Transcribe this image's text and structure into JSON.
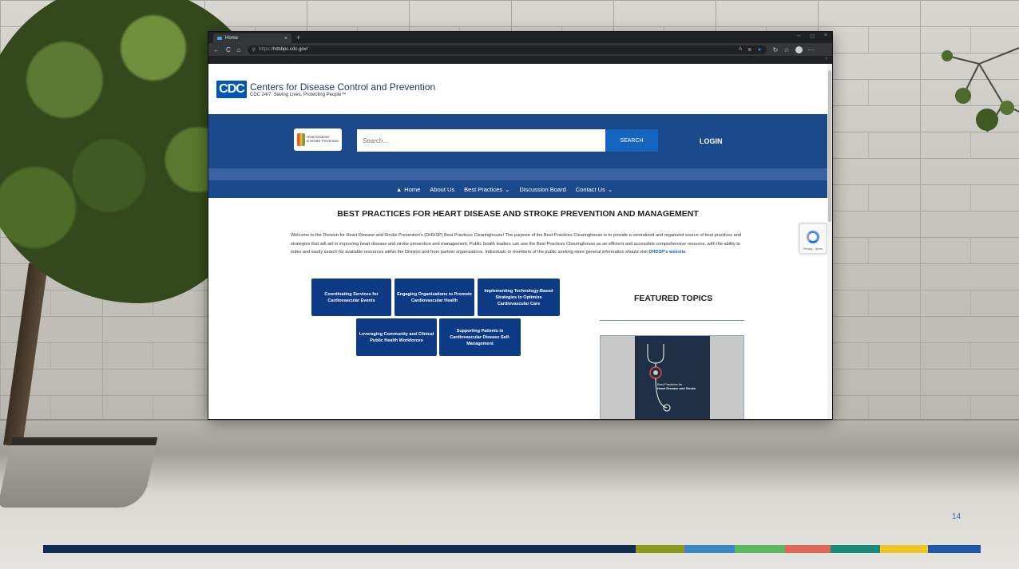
{
  "browser": {
    "tab_title": "Home",
    "tab_close": "×",
    "new_tab": "+",
    "window_controls": [
      "–",
      "◻",
      "×"
    ],
    "nav_icons": [
      "←",
      "C",
      "⌂"
    ],
    "lock": "⚲",
    "url_prefix": "https://",
    "url_host": "hdsbpc.cdc.gov",
    "url_suffix": "/",
    "more": "···",
    "subbar_chevron": "›"
  },
  "site": {
    "org_name": "Centers for Disease Control and Prevention",
    "tagline": "CDC 24/7: Saving Lives, Protecting People™",
    "logo_text": "CDC",
    "program_logo_line1": "Heart Disease",
    "program_logo_line2": "& Stroke Prevention",
    "search_placeholder": "Search...",
    "search_button": "SEARCH",
    "login": "LOGIN",
    "nav": [
      {
        "label": "Home",
        "icon": "home-icon"
      },
      {
        "label": "About Us"
      },
      {
        "label": "Best Practices",
        "dropdown": true
      },
      {
        "label": "Discussion Board"
      },
      {
        "label": "Contact Us",
        "dropdown": true
      }
    ],
    "title": "BEST PRACTICES FOR HEART DISEASE AND STROKE PREVENTION AND MANAGEMENT",
    "intro_text": "Welcome to the Division for Heart Disease and Stroke Prevention's (DHDSP) Best Practices Clearinghouse! The purpose of the Best Practices Clearinghouse is to provide a centralized and organized source of best practices and strategies that will aid in improving heart disease and stroke prevention and management. Public health leaders can use the Best Practices Clearinghouse as an efficient and accessible comprehensive resource, with the ability to index and easily search for available resources within the Division and from partner organizations. Individuals or members of the public seeking more general information should visit ",
    "intro_link": "DHDSP's website",
    "topics": [
      "Coordinating Services for Cardiovascular Events",
      "Engaging Organizations to Promote Cardiovascular Health",
      "Implementing Technology-Based Strategies to Optimize Cardiovascular Care",
      "Leveraging Community and Clinical Public Health Workforces",
      "Supporting Patients in Cardiovascular Disease Self-Management"
    ],
    "featured_heading": "FEATURED TOPICS",
    "featured_book_line1": "Best Practices for",
    "featured_book_line2": "Heart Disease and Stroke",
    "recaptcha_text": "Privacy - Terms"
  },
  "slide": {
    "number": "14",
    "bar_colors": [
      "#0f2d4f",
      "#8a9a1a",
      "#3a87c8",
      "#5cb85c",
      "#e0665a",
      "#1c8a7a",
      "#f2c51c",
      "#1f5aa8"
    ]
  },
  "colors": {
    "cdc_blue": "#1b4a8c",
    "button_blue": "#0c3a84",
    "search_blue": "#1565c0"
  }
}
